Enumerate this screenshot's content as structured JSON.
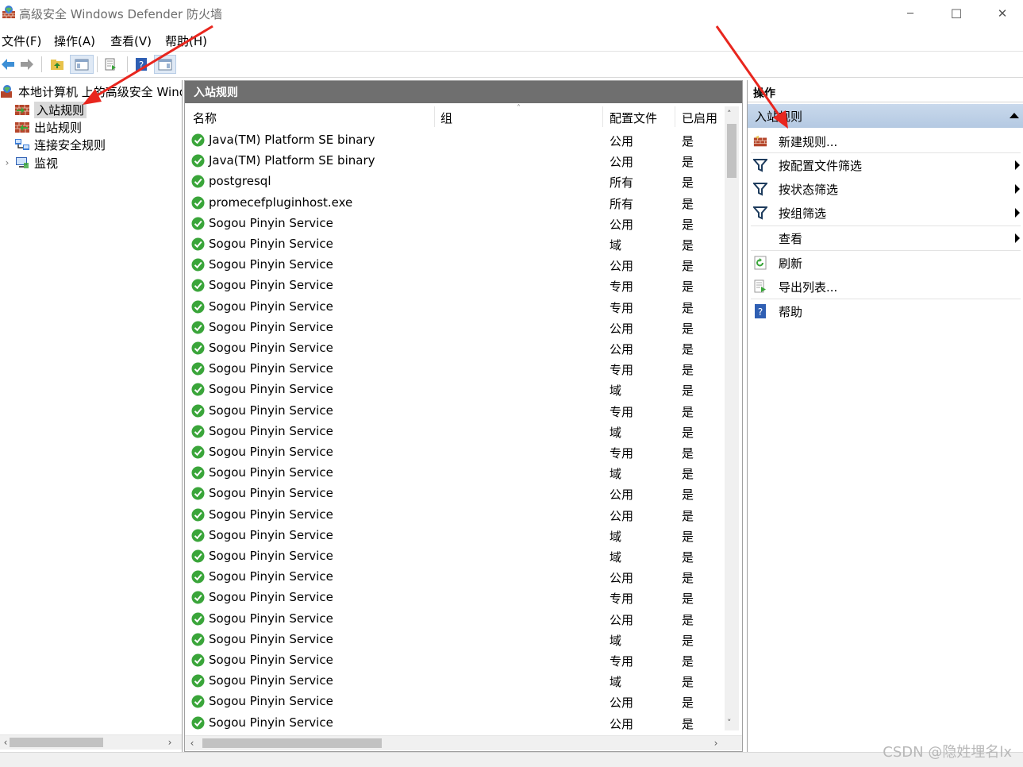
{
  "window": {
    "title": "高级安全 Windows Defender 防火墙",
    "minimize_glyph": "─",
    "maximize_glyph": "☐",
    "close_glyph": "✕"
  },
  "menu": [
    "文件(F)",
    "操作(A)",
    "查看(V)",
    "帮助(H)"
  ],
  "toolbar": {
    "buttons": [
      "back-icon",
      "forward-icon",
      "up-folder-icon",
      "show-hide-tree-icon",
      "export-list-icon",
      "help-icon",
      "show-hide-action-pane-icon"
    ]
  },
  "tree": {
    "root_label": "本地计算机 上的高级安全 Windows Defender 防火墙",
    "items": [
      {
        "label": "入站规则",
        "icon": "inbound-rules-icon",
        "selected": true
      },
      {
        "label": "出站规则",
        "icon": "outbound-rules-icon",
        "selected": false
      },
      {
        "label": "连接安全规则",
        "icon": "connection-security-icon",
        "selected": false
      },
      {
        "label": "监视",
        "icon": "monitor-icon",
        "selected": false
      }
    ],
    "expand_glyph": "›"
  },
  "center": {
    "title": "入站规则",
    "columns": {
      "name": "名称",
      "group": "组",
      "profile": "配置文件",
      "enabled": "已启用"
    },
    "rows": [
      {
        "name": "Java(TM) Platform SE binary",
        "profile": "公用",
        "enabled": "是"
      },
      {
        "name": "Java(TM) Platform SE binary",
        "profile": "公用",
        "enabled": "是"
      },
      {
        "name": "postgresql",
        "profile": "所有",
        "enabled": "是"
      },
      {
        "name": "promecefpluginhost.exe",
        "profile": "所有",
        "enabled": "是"
      },
      {
        "name": "Sogou Pinyin Service",
        "profile": "公用",
        "enabled": "是"
      },
      {
        "name": "Sogou Pinyin Service",
        "profile": "域",
        "enabled": "是"
      },
      {
        "name": "Sogou Pinyin Service",
        "profile": "公用",
        "enabled": "是"
      },
      {
        "name": "Sogou Pinyin Service",
        "profile": "专用",
        "enabled": "是"
      },
      {
        "name": "Sogou Pinyin Service",
        "profile": "专用",
        "enabled": "是"
      },
      {
        "name": "Sogou Pinyin Service",
        "profile": "公用",
        "enabled": "是"
      },
      {
        "name": "Sogou Pinyin Service",
        "profile": "公用",
        "enabled": "是"
      },
      {
        "name": "Sogou Pinyin Service",
        "profile": "专用",
        "enabled": "是"
      },
      {
        "name": "Sogou Pinyin Service",
        "profile": "域",
        "enabled": "是"
      },
      {
        "name": "Sogou Pinyin Service",
        "profile": "专用",
        "enabled": "是"
      },
      {
        "name": "Sogou Pinyin Service",
        "profile": "域",
        "enabled": "是"
      },
      {
        "name": "Sogou Pinyin Service",
        "profile": "专用",
        "enabled": "是"
      },
      {
        "name": "Sogou Pinyin Service",
        "profile": "域",
        "enabled": "是"
      },
      {
        "name": "Sogou Pinyin Service",
        "profile": "公用",
        "enabled": "是"
      },
      {
        "name": "Sogou Pinyin Service",
        "profile": "公用",
        "enabled": "是"
      },
      {
        "name": "Sogou Pinyin Service",
        "profile": "域",
        "enabled": "是"
      },
      {
        "name": "Sogou Pinyin Service",
        "profile": "域",
        "enabled": "是"
      },
      {
        "name": "Sogou Pinyin Service",
        "profile": "公用",
        "enabled": "是"
      },
      {
        "name": "Sogou Pinyin Service",
        "profile": "专用",
        "enabled": "是"
      },
      {
        "name": "Sogou Pinyin Service",
        "profile": "公用",
        "enabled": "是"
      },
      {
        "name": "Sogou Pinyin Service",
        "profile": "域",
        "enabled": "是"
      },
      {
        "name": "Sogou Pinyin Service",
        "profile": "专用",
        "enabled": "是"
      },
      {
        "name": "Sogou Pinyin Service",
        "profile": "域",
        "enabled": "是"
      },
      {
        "name": "Sogou Pinyin Service",
        "profile": "公用",
        "enabled": "是"
      },
      {
        "name": "Sogou Pinyin Service",
        "profile": "公用",
        "enabled": "是"
      }
    ]
  },
  "actions": {
    "title": "操作",
    "section_title": "入站规则",
    "items": [
      {
        "label": "新建规则...",
        "icon": "new-rule-icon",
        "submenu": false
      },
      {
        "label": "按配置文件筛选",
        "icon": "filter-icon",
        "submenu": true
      },
      {
        "label": "按状态筛选",
        "icon": "filter-icon",
        "submenu": true
      },
      {
        "label": "按组筛选",
        "icon": "filter-icon",
        "submenu": true
      },
      {
        "label": "查看",
        "icon": "",
        "submenu": true
      },
      {
        "label": "刷新",
        "icon": "refresh-icon",
        "submenu": false
      },
      {
        "label": "导出列表...",
        "icon": "export-list-icon",
        "submenu": false
      },
      {
        "label": "帮助",
        "icon": "help-icon",
        "submenu": false
      }
    ]
  },
  "watermark": "CSDN @隐姓埋名lx",
  "colors": {
    "annotation_arrow": "#e8261e",
    "pane_header": "#6f6f6f",
    "action_section": "#bcd0e6",
    "rule_check": "#3aa53a"
  }
}
